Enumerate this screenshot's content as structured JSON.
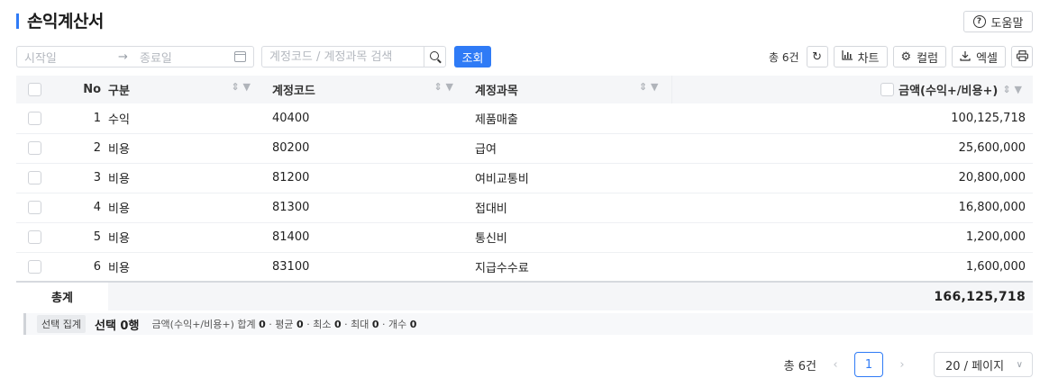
{
  "header": {
    "title": "손익계산서",
    "help_label": "도움말"
  },
  "filters": {
    "start_placeholder": "시작일",
    "end_placeholder": "종료일",
    "search_placeholder": "계정코드 / 계정과목 검색",
    "query_label": "조회"
  },
  "tools": {
    "total_count": "총 6건",
    "chart_label": "차트",
    "column_label": "컬럼",
    "excel_label": "엑셀"
  },
  "table": {
    "columns": {
      "no": "No",
      "type": "구분",
      "code": "계정코드",
      "name": "계정과목",
      "amount": "금액(수익+/비용+)"
    },
    "rows": [
      {
        "no": "1",
        "type": "수익",
        "code": "40400",
        "name": "제품매출",
        "amount": "100,125,718"
      },
      {
        "no": "2",
        "type": "비용",
        "code": "80200",
        "name": "급여",
        "amount": "25,600,000"
      },
      {
        "no": "3",
        "type": "비용",
        "code": "81200",
        "name": "여비교통비",
        "amount": "20,800,000"
      },
      {
        "no": "4",
        "type": "비용",
        "code": "81300",
        "name": "접대비",
        "amount": "16,800,000"
      },
      {
        "no": "5",
        "type": "비용",
        "code": "81400",
        "name": "통신비",
        "amount": "1,200,000"
      },
      {
        "no": "6",
        "type": "비용",
        "code": "83100",
        "name": "지급수수료",
        "amount": "1,600,000"
      }
    ],
    "footer": {
      "label": "총계",
      "total": "166,125,718"
    }
  },
  "summary": {
    "tag": "선택 집계",
    "selected": "선택 0행",
    "field_label": "금액(수익+/비용+)",
    "sum_label": "합계",
    "sum": "0",
    "avg_label": "평균",
    "avg": "0",
    "min_label": "최소",
    "min": "0",
    "max_label": "최대",
    "max": "0",
    "count_label": "개수",
    "count": "0"
  },
  "pagination": {
    "total": "총 6건",
    "current_page": "1",
    "page_size": "20 / 페이지"
  },
  "colors": {
    "accent": "#2f7bf6",
    "header_bg": "#f5f6f8"
  }
}
